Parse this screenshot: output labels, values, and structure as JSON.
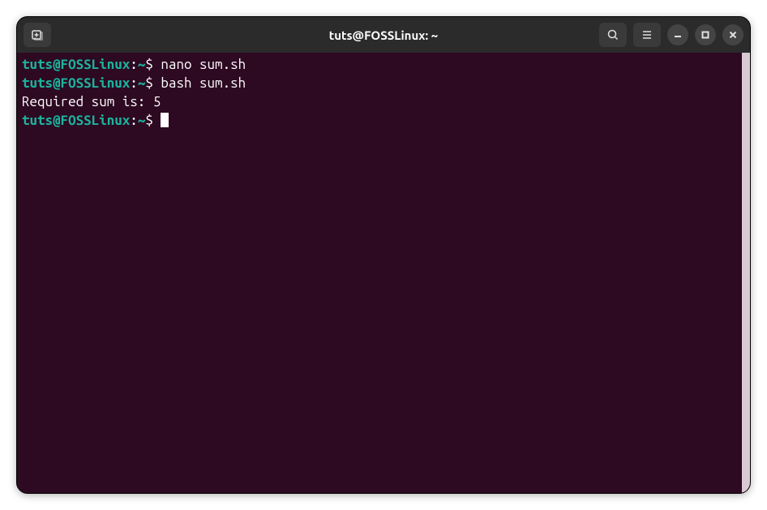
{
  "window": {
    "title": "tuts@FOSSLinux: ~"
  },
  "prompt": {
    "user_host": "tuts@FOSSLinux",
    "separator": ":",
    "path": "~",
    "symbol": "$"
  },
  "lines": [
    {
      "type": "command",
      "text": "nano sum.sh"
    },
    {
      "type": "command",
      "text": "bash sum.sh"
    },
    {
      "type": "output",
      "text": "Required sum is: 5"
    },
    {
      "type": "prompt",
      "text": ""
    }
  ]
}
